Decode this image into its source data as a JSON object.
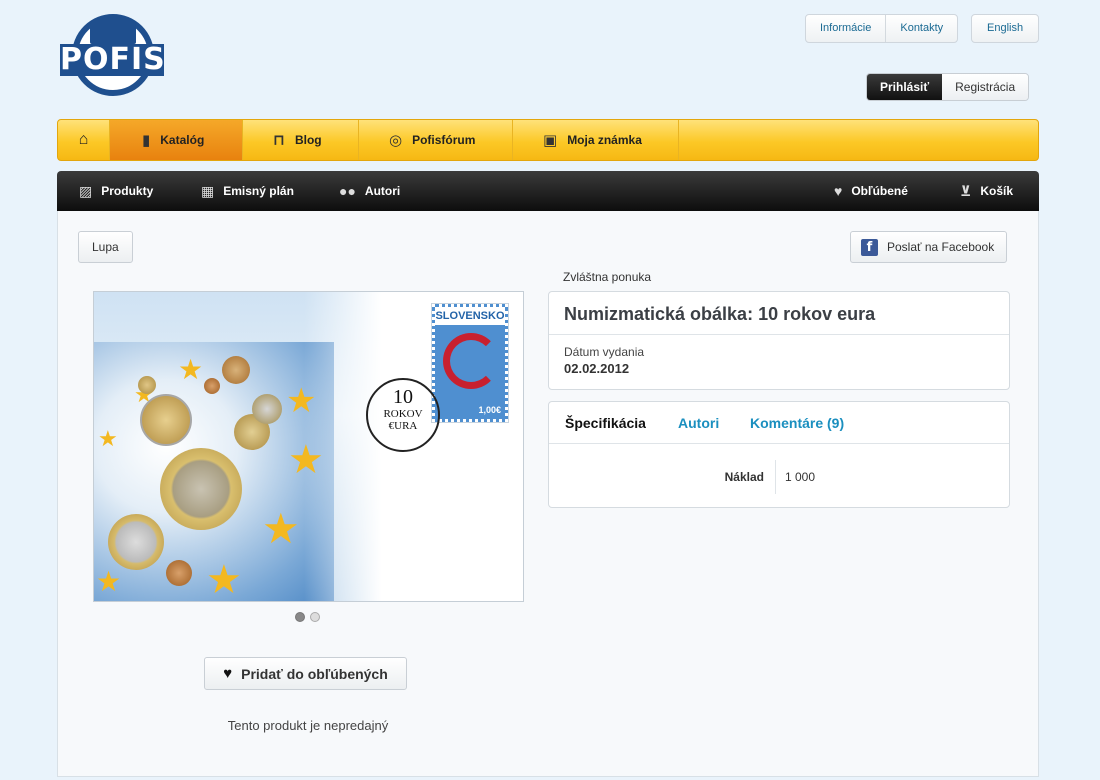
{
  "logo": {
    "text": "POFIS"
  },
  "top_links": [
    "Informácie",
    "Kontakty"
  ],
  "language": "English",
  "auth": {
    "login": "Prihlásiť",
    "register": "Registrácia"
  },
  "main_nav": [
    {
      "label": "Katalóg",
      "icon": "book-icon",
      "active": true
    },
    {
      "label": "Blog",
      "icon": "open-book-icon",
      "active": false
    },
    {
      "label": "Pofisfórum",
      "icon": "chat-icon",
      "active": false
    },
    {
      "label": "Moja známka",
      "icon": "stamp-frame-icon",
      "active": false
    }
  ],
  "sub_nav": {
    "left": [
      {
        "label": "Produkty",
        "icon": "image-icon"
      },
      {
        "label": "Emisný plán",
        "icon": "calendar-icon"
      },
      {
        "label": "Autori",
        "icon": "users-icon"
      }
    ],
    "right": [
      {
        "label": "Obľúbené",
        "icon": "heart-icon"
      },
      {
        "label": "Košík",
        "icon": "cart-icon"
      }
    ]
  },
  "toolbar": {
    "zoom": "Lupa",
    "facebook": "Poslať na Facebook"
  },
  "product": {
    "category": "Zvláštna ponuka",
    "title": "Numizmatická obálka: 10 rokov eura",
    "date_label": "Dátum vydania",
    "date_value": "02.02.2012",
    "image": {
      "stamp_country": "SLOVENSKO",
      "stamp_value": "1,00€",
      "postmark_number": "10",
      "postmark_line1": "ROKOV",
      "postmark_line2": "€URA"
    },
    "carousel": {
      "count": 2,
      "active": 1
    },
    "add_favorite": "Pridať do obľúbených",
    "availability": "Tento produkt je nepredajný"
  },
  "tabs": [
    {
      "label": "Špecifikácia",
      "selected": true
    },
    {
      "label": "Autori",
      "selected": false
    },
    {
      "label": "Komentáre (9)",
      "selected": false
    }
  ],
  "specs": [
    {
      "key": "Náklad",
      "value": "1 000"
    }
  ],
  "colors": {
    "accent": "#1b8fbf",
    "nav_yellow": "#fcc826",
    "nav_active": "#e8820e",
    "brand_blue": "#1f4f8e"
  }
}
